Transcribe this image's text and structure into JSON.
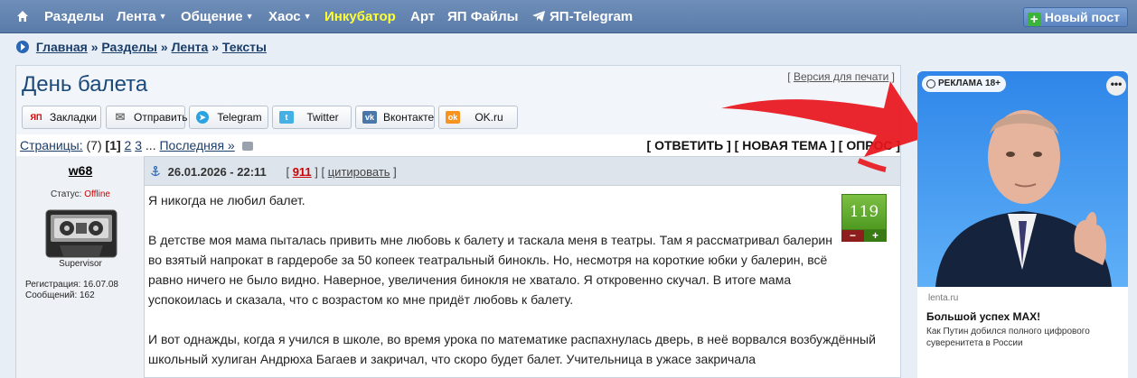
{
  "nav": {
    "items": [
      {
        "label": "Разделы",
        "caret": false,
        "highlight": false
      },
      {
        "label": "Лента",
        "caret": true,
        "highlight": false
      },
      {
        "label": "Общение",
        "caret": true,
        "highlight": false
      },
      {
        "label": "Хаос",
        "caret": true,
        "highlight": false
      },
      {
        "label": "Инкубатор",
        "caret": false,
        "highlight": true
      },
      {
        "label": "Арт",
        "caret": false,
        "highlight": false
      },
      {
        "label": "ЯП Файлы",
        "caret": false,
        "highlight": false
      },
      {
        "label": "ЯП-Telegram",
        "caret": false,
        "highlight": false
      }
    ],
    "new_post": "Новый пост",
    "highlight_color": "#ffff33"
  },
  "breadcrumb": {
    "items": [
      "Главная",
      "Разделы",
      "Лента",
      "Тексты"
    ],
    "separator": "»"
  },
  "topic": {
    "title": "День балета",
    "print_link": "Версия для печати"
  },
  "share": [
    {
      "label": "Закладки",
      "icon": "yap-bookmark-icon",
      "color": "#cc0000",
      "glyph": "ЯП"
    },
    {
      "label": "Отправить",
      "icon": "envelope-icon",
      "color": "#888888",
      "glyph": "✉"
    },
    {
      "label": "Telegram",
      "icon": "telegram-icon",
      "color": "#2aa3e0",
      "glyph": "➤"
    },
    {
      "label": "Twitter",
      "icon": "twitter-icon",
      "color": "#45b0e3",
      "glyph": "t"
    },
    {
      "label": "Вконтакте",
      "icon": "vk-icon",
      "color": "#4a76a8",
      "glyph": "vk"
    },
    {
      "label": "OK.ru",
      "icon": "ok-icon",
      "color": "#f7931e",
      "glyph": "ok"
    }
  ],
  "pager": {
    "label": "Страницы:",
    "count": "(7)",
    "current": "[1]",
    "pages": [
      "2",
      "3"
    ],
    "ellipsis": "...",
    "last": "Последняя »",
    "actions": "[ ОТВЕТИТЬ ] [ НОВАЯ ТЕМА ] [ ОПРОС ]"
  },
  "post": {
    "author": "w68",
    "status_label": "Статус:",
    "status_value": "Offline",
    "rank": "Supervisor",
    "registration": "Регистрация: 16.07.08",
    "messages": "Сообщений: 162",
    "date": "26.01.2026 - 22:11",
    "number": "911",
    "quote": "цитировать",
    "rating": "119",
    "minus": "−",
    "plus": "+",
    "paragraphs": [
      "Я никогда не любил балет.",
      "В детстве моя мама пыталась привить мне любовь к балету и таскала меня в театры. Там я рассматривал балерин во взятый напрокат в гардеробе за 50 копеек театральный бинокль. Но, несмотря на короткие юбки у балерин, всё равно ничего не было видно. Наверное, увеличения бинокля не хватало. Я откровенно скучал. В итоге мама успокоилась и сказала, что с возрастом ко мне придёт любовь к балету.",
      "И вот однажды, когда я учился в школе, во время урока по математике распахнулась дверь, в неё ворвался возбуждённый школьный хулиган Андрюха Багаев и закричал, что скоро будет балет. Учительница в ужасе закричала"
    ]
  },
  "ad": {
    "badge": "РЕКЛАМА 18+",
    "more": "•••",
    "domain": "lenta.ru",
    "headline": "Большой успех MAX!",
    "description": "Как Путин добился полного цифрового суверенитета в России"
  }
}
